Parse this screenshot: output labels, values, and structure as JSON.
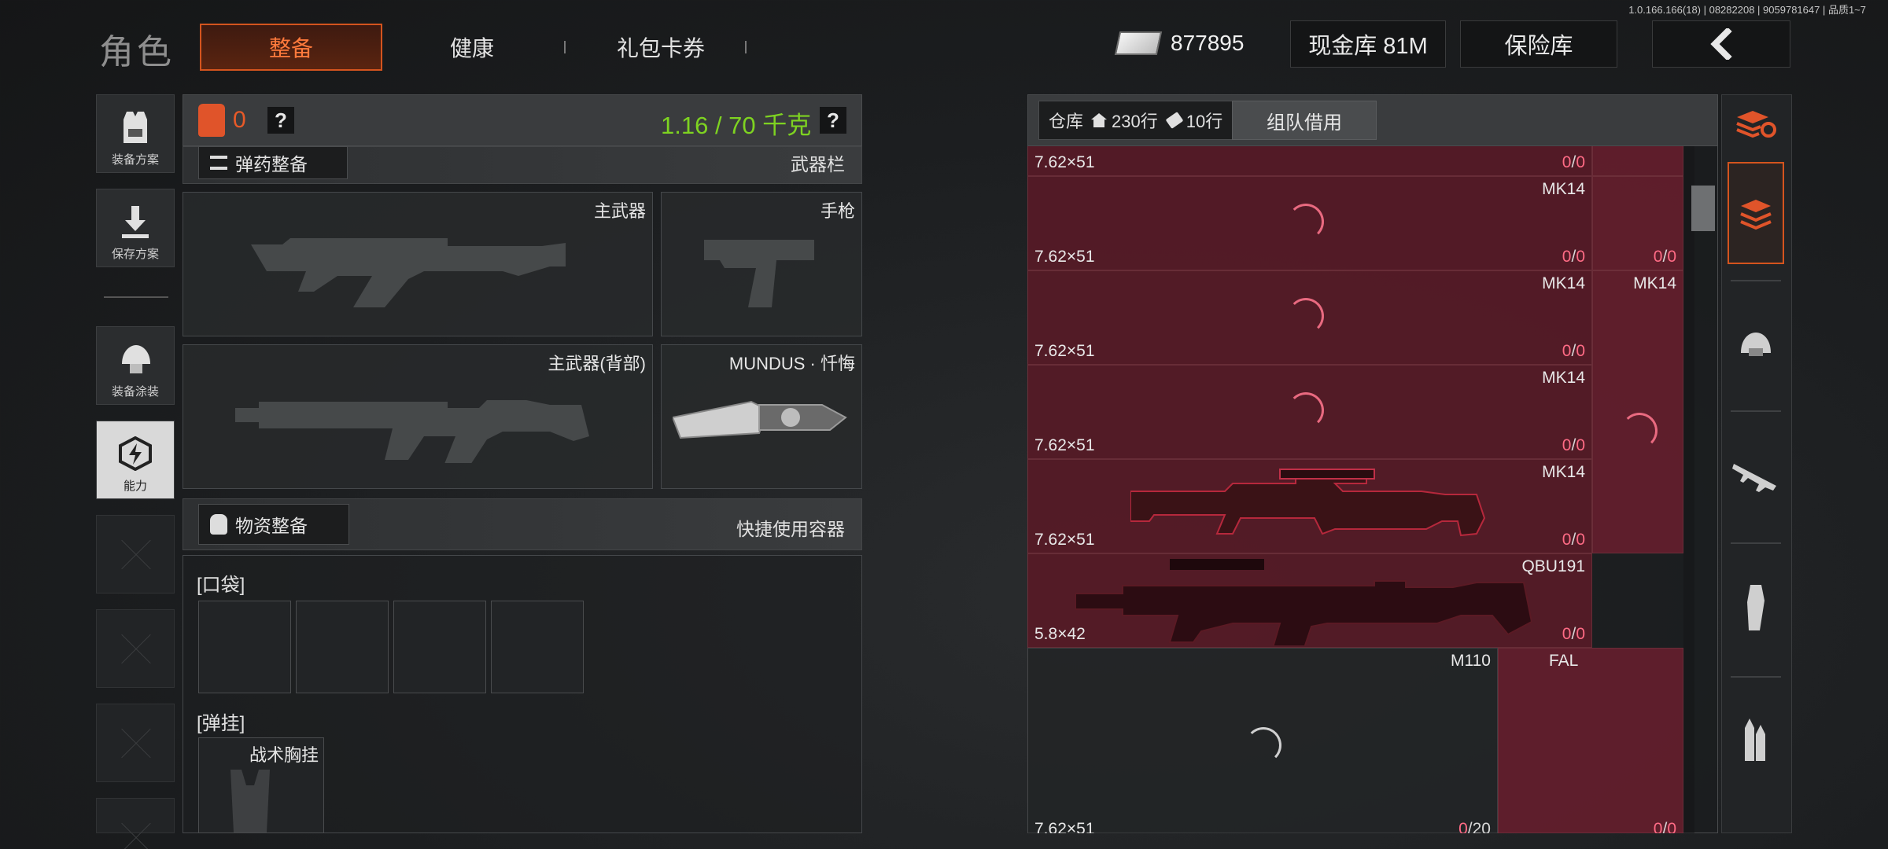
{
  "build_info": "1.0.166.166(18) | 08282208 | 9059781647 | 品质1~7",
  "header": {
    "title": "角色",
    "tabs": [
      {
        "label": "整备",
        "active": true
      },
      {
        "label": "健康",
        "active": false
      },
      {
        "label": "礼包卡券",
        "active": false
      }
    ],
    "currency_amount": "877895",
    "cash_vault_label": "现金库 81M",
    "safe_box_label": "保险库",
    "back_icon": "chevron-left-icon"
  },
  "left_rail": [
    {
      "label": "装备方案",
      "icon": "vest-icon"
    },
    {
      "label": "保存方案",
      "icon": "download-icon"
    },
    {
      "label": "装备涂装",
      "icon": "helmet-icon"
    },
    {
      "label": "能力",
      "icon": "hex-lightning-icon",
      "active": true
    }
  ],
  "loadout": {
    "armor_count": "0",
    "help_mark": "?",
    "weight": "1.16 / 70 千克",
    "ammo_section_label": "弹药整备",
    "weapon_bar_label": "武器栏",
    "slots": {
      "primary": "主武器",
      "pistol": "手枪",
      "primary_back": "主武器(背部)",
      "melee": "MUNDUS · 忏悔"
    },
    "supply_section_label": "物资整备",
    "quick_container_label": "快捷使用容器",
    "pocket_label": "[口袋]",
    "rig_label": "[弹挂]",
    "rig_item": "战术胸挂"
  },
  "warehouse": {
    "tag_prefix": "仓库",
    "rows": "230行",
    "tag_rows": "10行",
    "borrow_label": "组队借用",
    "items": [
      {
        "name": "",
        "cal": "7.62×51",
        "ammo_a": "0",
        "ammo_b": "0"
      },
      {
        "name": "MK14",
        "cal": "7.62×51",
        "ammo_a": "0",
        "ammo_b": "0"
      },
      {
        "name": "MK14",
        "cal": "7.62×51",
        "ammo_a": "0",
        "ammo_b": "0"
      },
      {
        "name": "MK14",
        "cal": "7.62×51",
        "ammo_a": "0",
        "ammo_b": "0"
      },
      {
        "name": "MK14",
        "cal": "7.62×51",
        "ammo_a": "0",
        "ammo_b": "0"
      },
      {
        "name": "QBU191",
        "cal": "5.8×42",
        "ammo_a": "0",
        "ammo_b": "0"
      },
      {
        "name": "M110",
        "cal": "7.62×51",
        "ammo_a": "0",
        "ammo_b": "/20"
      }
    ],
    "side_items": [
      {
        "name": "",
        "ammo_a": "0",
        "ammo_b": "0"
      },
      {
        "name": "MK14",
        "ammo_a": "",
        "ammo_b": ""
      },
      {
        "name": "FAL",
        "ammo_a": "",
        "ammo_b": ""
      },
      {
        "name": "",
        "ammo_a": "0",
        "ammo_b": "0"
      }
    ]
  },
  "category_rail": [
    "sort-layers-icon",
    "layers-icon",
    "helmet-icon",
    "rifle-icon",
    "magazine-icon",
    "bullets-icon"
  ],
  "colors": {
    "accent": "#d4541e",
    "weight_green": "#7ed321",
    "ammo_pink": "#ff6b85"
  }
}
